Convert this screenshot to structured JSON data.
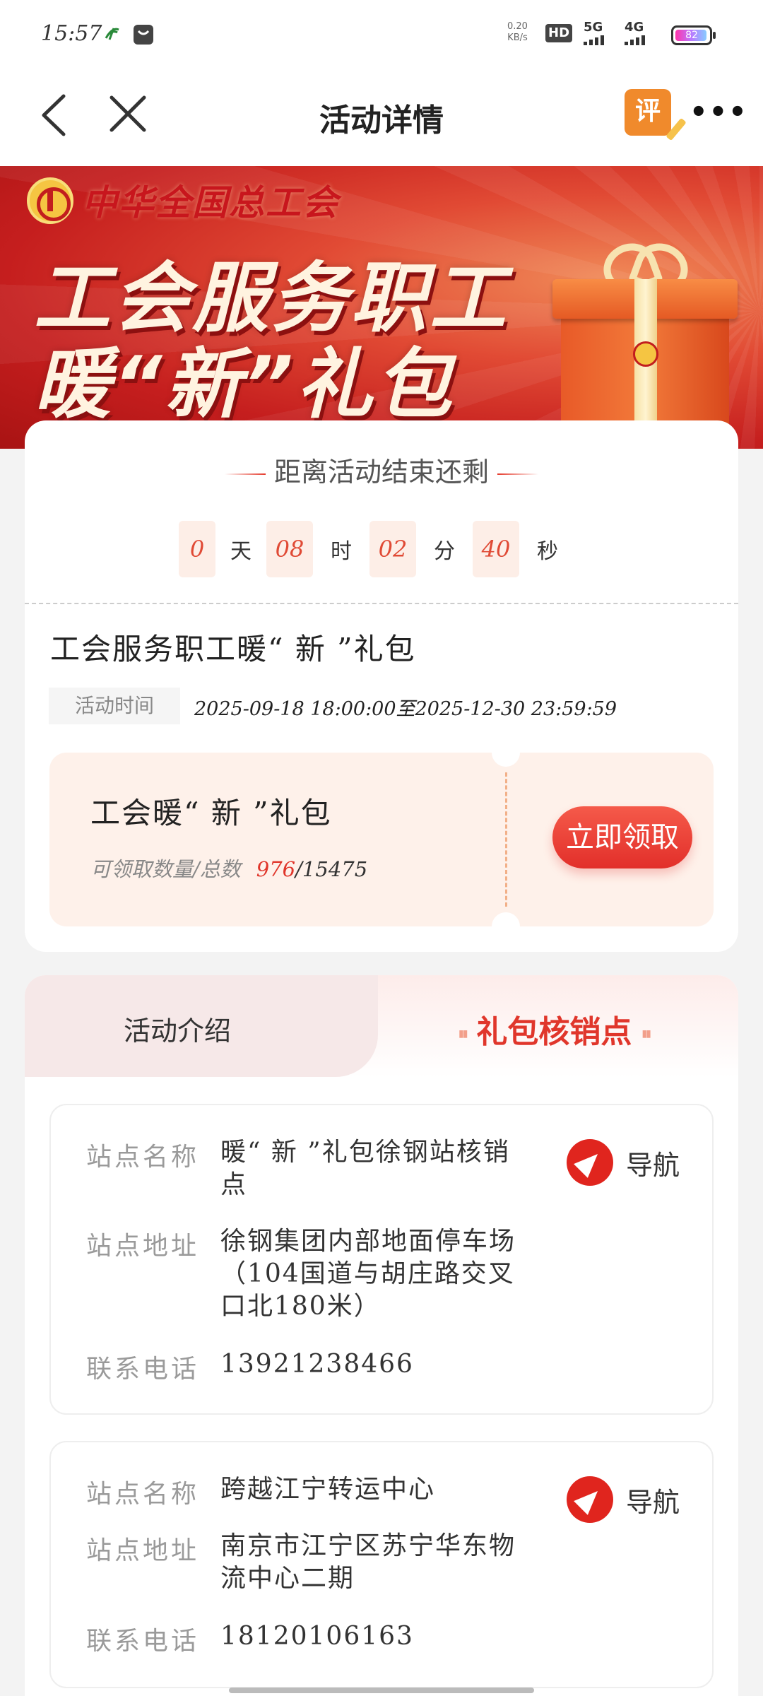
{
  "status_bar": {
    "time": "15:57",
    "net_speed_value": "0.20",
    "net_speed_unit": "KB/s",
    "hd_label": "HD",
    "sim1": "5G",
    "sim2": "4G",
    "battery_level": "82"
  },
  "nav": {
    "title": "活动详情",
    "review_label": "评",
    "more_label": "•••"
  },
  "banner": {
    "org_name": "中华全国总工会",
    "line1": "工会服务职工",
    "line2": "暖“新”礼包"
  },
  "countdown": {
    "title": "距离活动结束还剩",
    "days": "0",
    "days_unit": "天",
    "hours": "08",
    "hours_unit": "时",
    "minutes": "02",
    "minutes_unit": "分",
    "seconds": "40",
    "seconds_unit": "秒"
  },
  "activity": {
    "title": "工会服务职工暖“ 新 ”礼包",
    "time_label": "活动时间",
    "time_value": "2025-09-18 18:00:00至2025-12-30 23:59:59"
  },
  "coupon": {
    "name": "工会暖“ 新 ”礼包",
    "qty_label": "可领取数量/总数",
    "available": "976",
    "total": "/15475",
    "claim_label": "立即领取"
  },
  "tabs": [
    {
      "label": "活动介绍",
      "active": false
    },
    {
      "label": "礼包核销点",
      "active": true
    }
  ],
  "sites": [
    {
      "name_label": "站点名称",
      "name": "暖“ 新 ”礼包徐钢站核销点",
      "addr_label": "站点地址",
      "addr": "徐钢集团内部地面停车场（104国道与胡庄路交叉口北180米）",
      "phone_label": "联系电话",
      "phone": "13921238466",
      "nav_label": "导航"
    },
    {
      "name_label": "站点名称",
      "name": "跨越江宁转运中心",
      "addr_label": "站点地址",
      "addr": "南京市江宁区苏宁华东物流中心二期",
      "phone_label": "联系电话",
      "phone": "18120106163",
      "nav_label": "导航"
    }
  ],
  "colors": {
    "accent": "#e0362b",
    "coupon_bg": "#fef1ea",
    "countdown_box_bg": "#fdeee7"
  }
}
